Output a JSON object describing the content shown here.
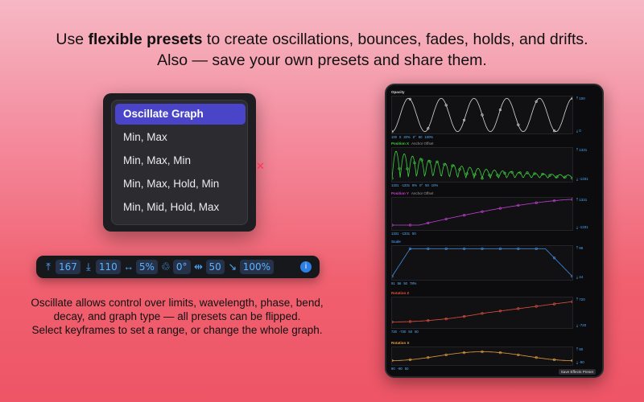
{
  "headline": {
    "pre": "Use ",
    "bold": "flexible presets",
    "post": " to create oscillations, bounces, fades, holds, and drifts.",
    "line2": "Also — save your own presets and share them."
  },
  "menu": {
    "items": [
      {
        "label": "Oscillate Graph",
        "selected": true
      },
      {
        "label": "Min, Max",
        "selected": false
      },
      {
        "label": "Min, Max, Min",
        "selected": false
      },
      {
        "label": "Min, Max, Hold, Min",
        "selected": false
      },
      {
        "label": "Min, Mid, Hold, Max",
        "selected": false
      }
    ]
  },
  "toolbar": {
    "max": "167",
    "min": "110",
    "wavelength": "5%",
    "phase": "0°",
    "bend": "50",
    "decay": "100%"
  },
  "caption": {
    "line1": "Oscillate allows control over limits, wavelength, phase, bend,",
    "line2": "decay, and graph type — all presets can be flipped.",
    "line3": "Select keyframes to set a range, or change the whole graph."
  },
  "tablet": {
    "save_label": "Save Effects Preset",
    "panels": [
      {
        "title": "Opacity",
        "color": "#d8d8d8",
        "top_val": "100",
        "bottom_val": "0",
        "tag": "",
        "footer": [
          "100",
          "0",
          "20%",
          "0°",
          "50",
          "100%"
        ]
      },
      {
        "title": "Position X",
        "color": "#3fcf3f",
        "top_val": "1331",
        "bottom_val": "-1331",
        "tag": "Anchor Offset",
        "footer": [
          "1331",
          "-1331",
          "8%",
          "0°",
          "50",
          "10%"
        ]
      },
      {
        "title": "Position Y",
        "color": "#c43fd6",
        "top_val": "1331",
        "bottom_val": "-1331",
        "tag": "Anchor Offset",
        "footer": [
          "1331",
          "-1331",
          "50"
        ]
      },
      {
        "title": "Scale",
        "color": "#3f8fe6",
        "top_val": "96",
        "bottom_val": "44",
        "tag": "",
        "footer": [
          "91",
          "56",
          "50",
          "78%"
        ]
      },
      {
        "title": "Rotation Z",
        "color": "#e6503f",
        "top_val": "720",
        "bottom_val": "-720",
        "tag": "",
        "footer": [
          "720",
          "-720",
          "50",
          "50"
        ]
      },
      {
        "title": "Rotation X",
        "color": "#e6a03f",
        "top_val": "90",
        "bottom_val": "-90",
        "tag": "",
        "footer": [
          "90",
          "-90",
          "50"
        ]
      }
    ]
  }
}
